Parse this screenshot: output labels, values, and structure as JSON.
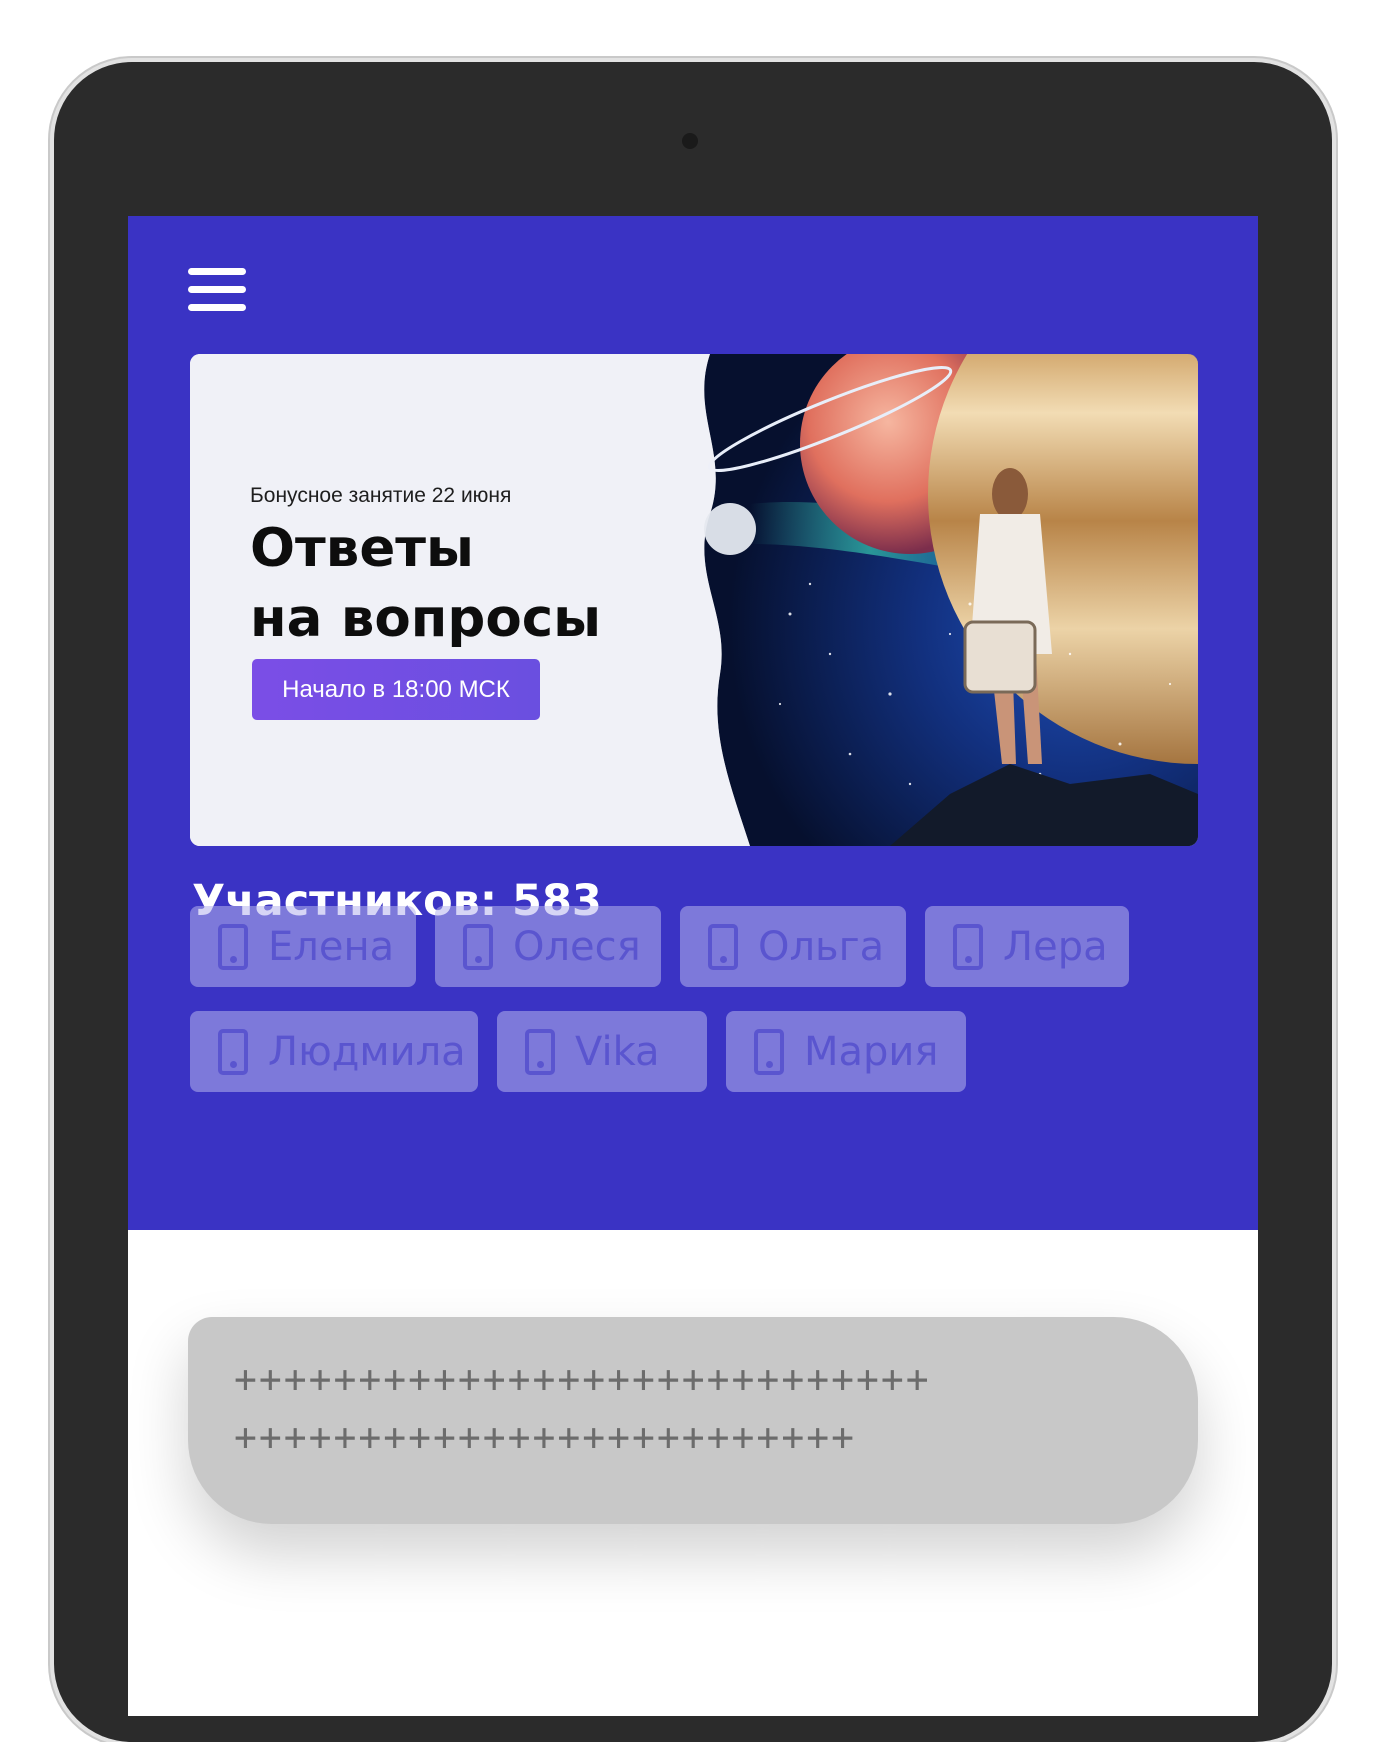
{
  "banner": {
    "subtitle": "Бонусное занятие 22 июня",
    "title_line1": "Ответы",
    "title_line2": "на вопросы",
    "start_button_label": "Начало в 18:00 МСК"
  },
  "participants": {
    "label": "Участников: 583",
    "items": [
      {
        "name": "Елена",
        "icon": "phone-icon"
      },
      {
        "name": "Олеся",
        "icon": "phone-icon"
      },
      {
        "name": "Ольга",
        "icon": "phone-icon"
      },
      {
        "name": "Лера",
        "icon": "phone-icon"
      },
      {
        "name": "Людмила",
        "icon": "phone-icon"
      },
      {
        "name": "Vika",
        "icon": "phone-icon"
      },
      {
        "name": "Мария",
        "icon": "phone-icon"
      }
    ]
  },
  "message": {
    "line1": "++++++++++++++++++++++++++++",
    "line2": "+++++++++++++++++++++++++"
  },
  "colors": {
    "header_bg": "#3a33c4",
    "accent": "#7b4ee6",
    "chip_text": "#5a55cf",
    "bubble_bg": "#c8c8c8"
  }
}
